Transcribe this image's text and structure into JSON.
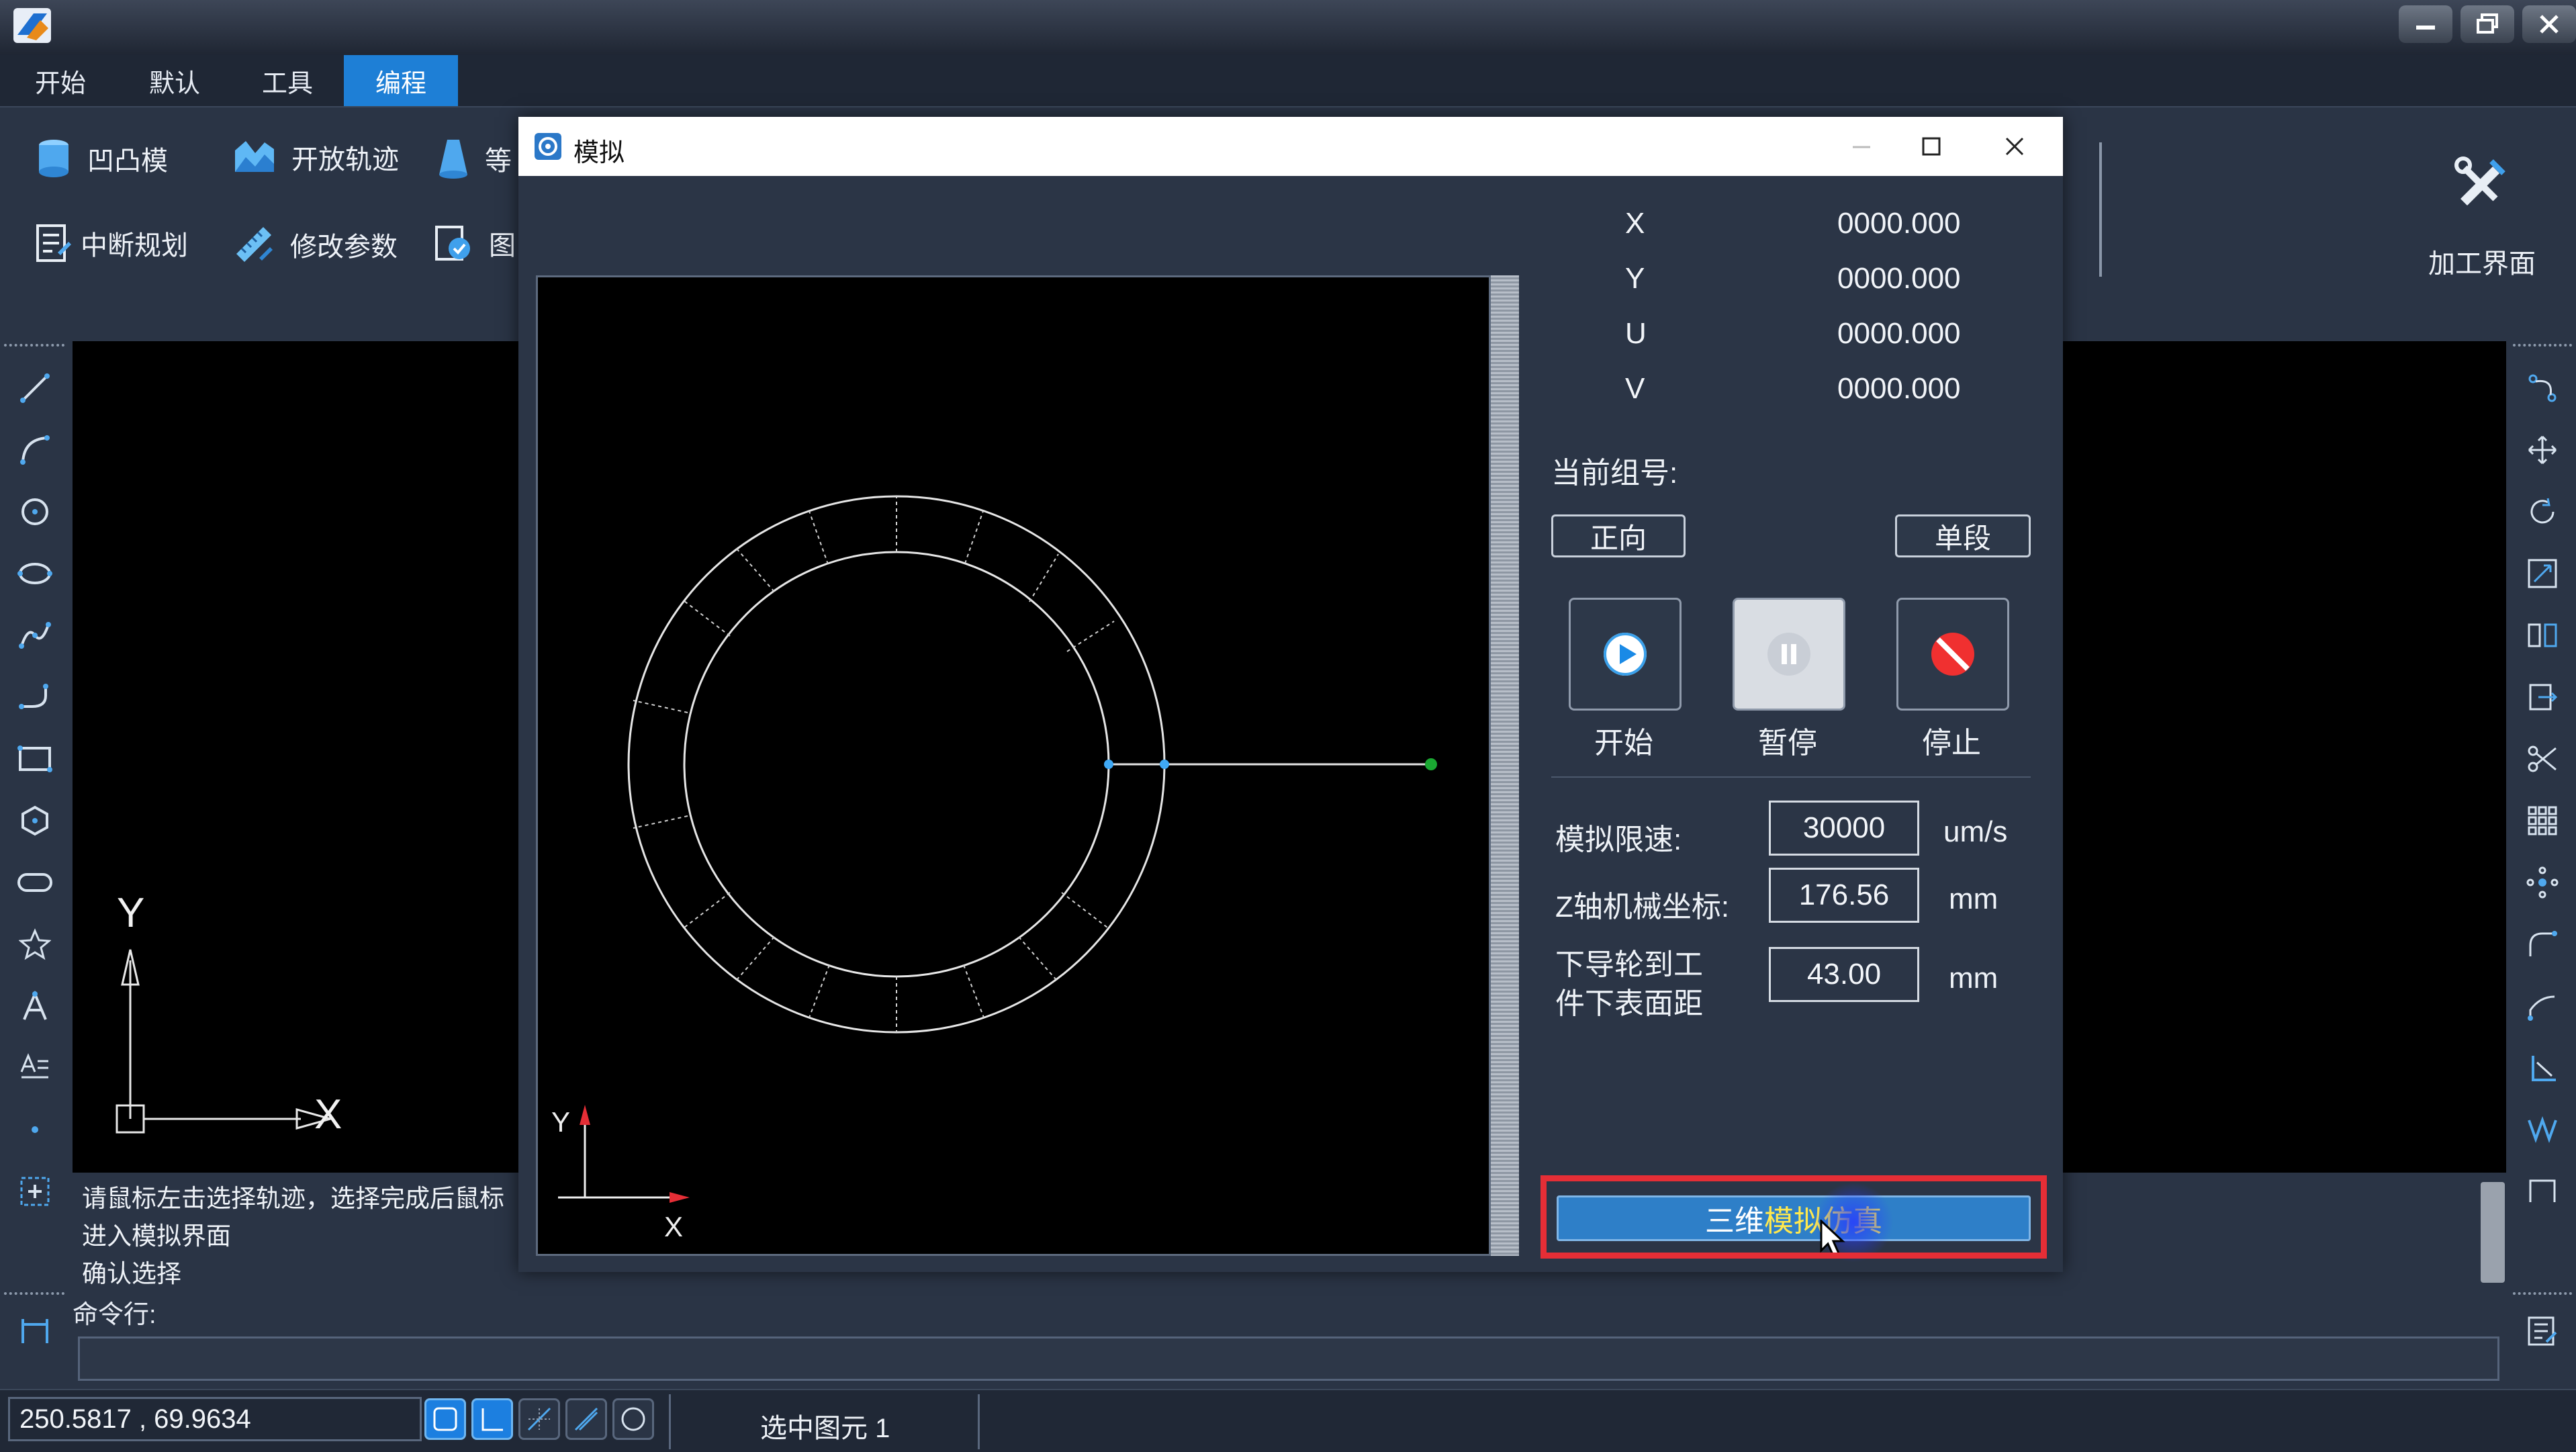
{
  "menu": {
    "items": [
      {
        "label": "开始"
      },
      {
        "label": "默认"
      },
      {
        "label": "工具"
      },
      {
        "label": "编程",
        "active": true
      }
    ]
  },
  "ribbon": {
    "row1": [
      {
        "label": "凹凸模",
        "icon": "cylinder-icon"
      },
      {
        "label": "开放轨迹",
        "icon": "wave-icon"
      },
      {
        "label": "等",
        "icon": "cone-icon"
      }
    ],
    "row2": [
      {
        "label": "中断规划",
        "icon": "list-edit-icon"
      },
      {
        "label": "修改参数",
        "icon": "ruler-pencil-icon"
      },
      {
        "label": "图",
        "icon": "doc-check-icon"
      }
    ],
    "right": {
      "label": "加工界面",
      "icon": "tools-icon"
    }
  },
  "canvas_left": {
    "y_label": "Y",
    "x_label": "X"
  },
  "messages": [
    "请鼠标左击选择轨迹，选择完成后鼠标",
    "进入模拟界面",
    "确认选择"
  ],
  "command": {
    "label": "命令行:",
    "value": ""
  },
  "status": {
    "coords": "250.5817 , 69.9634",
    "selected": "选中图元 1"
  },
  "dialog": {
    "title": "模拟",
    "axes": [
      {
        "name": "X",
        "value": "0000.000"
      },
      {
        "name": "Y",
        "value": "0000.000"
      },
      {
        "name": "U",
        "value": "0000.000"
      },
      {
        "name": "V",
        "value": "0000.000"
      }
    ],
    "group_label": "当前组号:",
    "direction_button": "正向",
    "mode_button": "单段",
    "controls": [
      {
        "label": "开始",
        "icon": "play-icon"
      },
      {
        "label": "暂停",
        "icon": "pause-icon"
      },
      {
        "label": "停止",
        "icon": "stop-icon"
      }
    ],
    "params": [
      {
        "label": "模拟限速:",
        "value": "30000",
        "unit": "um/s"
      },
      {
        "label": "Z轴机械坐标:",
        "value": "176.56",
        "unit": "mm"
      },
      {
        "label_line1": "下导轮到工",
        "label_line2": "件下表面距",
        "value": "43.00",
        "unit": "mm"
      }
    ],
    "sim3d_button_prefix": "三维",
    "sim3d_button_highlight": "模拟仿真",
    "canvas": {
      "y_label": "Y",
      "x_label": "X"
    }
  },
  "colors": {
    "accent": "#1e7fd6",
    "highlight_box": "#e52e36",
    "sim_button": "#2e7fc8",
    "highlight_text": "#ffe84d",
    "entry_point": "#1aa832",
    "node_point": "#3fa9f5"
  }
}
